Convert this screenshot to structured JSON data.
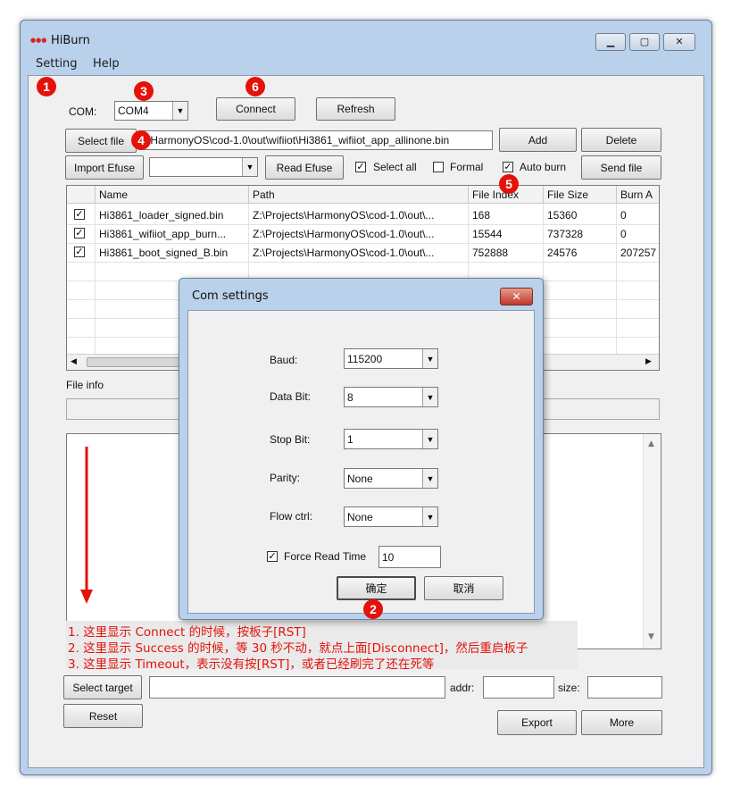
{
  "window": {
    "title": "HiBurn",
    "minimize": "▁",
    "maximize": "▢",
    "close": "✕"
  },
  "menu": {
    "setting": "Setting",
    "help": "Help"
  },
  "com": {
    "label": "COM:",
    "value": "COM4"
  },
  "buttons": {
    "connect": "Connect",
    "refresh": "Refresh",
    "select_file": "Select file",
    "add": "Add",
    "delete": "Delete",
    "import_efuse": "Import Efuse",
    "read_efuse": "Read Efuse",
    "send_file": "Send file",
    "select_target": "Select target",
    "reset": "Reset",
    "export": "Export",
    "more": "More"
  },
  "file_path": "s\\HarmonyOS\\cod-1.0\\out\\wifiiot\\Hi3861_wifiiot_app_allinone.bin",
  "efuse_value": "",
  "checkboxes": {
    "select_all": {
      "label": "Select all",
      "checked": true
    },
    "formal": {
      "label": "Formal",
      "checked": false
    },
    "auto_burn": {
      "label": "Auto burn",
      "checked": true
    }
  },
  "table": {
    "headers": [
      "",
      "Name",
      "Path",
      "File Index",
      "File Size",
      "Burn A"
    ],
    "rows": [
      {
        "checked": true,
        "name": "Hi3861_loader_signed.bin",
        "path": "Z:\\Projects\\HarmonyOS\\cod-1.0\\out\\...",
        "index": "168",
        "size": "15360",
        "burn": "0"
      },
      {
        "checked": true,
        "name": "Hi3861_wifiiot_app_burn...",
        "path": "Z:\\Projects\\HarmonyOS\\cod-1.0\\out\\...",
        "index": "15544",
        "size": "737328",
        "burn": "0"
      },
      {
        "checked": true,
        "name": "Hi3861_boot_signed_B.bin",
        "path": "Z:\\Projects\\HarmonyOS\\cod-1.0\\out\\...",
        "index": "752888",
        "size": "24576",
        "burn": "207257"
      }
    ]
  },
  "file_info": {
    "label": "File info",
    "value": ""
  },
  "target": {
    "value": "",
    "addr_label": "addr:",
    "addr_value": "",
    "size_label": "size:",
    "size_value": ""
  },
  "dialog": {
    "title": "Com settings",
    "close": "✕",
    "baud": {
      "label": "Baud:",
      "value": "115200"
    },
    "data_bit": {
      "label": "Data Bit:",
      "value": "8"
    },
    "stop_bit": {
      "label": "Stop Bit:",
      "value": "1"
    },
    "parity": {
      "label": "Parity:",
      "value": "None"
    },
    "flow_ctrl": {
      "label": "Flow ctrl:",
      "value": "None"
    },
    "force_read_time": {
      "label": "Force Read Time",
      "checked": true,
      "value": "10"
    },
    "ok": "确定",
    "cancel": "取消"
  },
  "annotations": {
    "badges": [
      "1",
      "2",
      "3",
      "4",
      "5",
      "6"
    ],
    "notes": [
      "1. 这里显示 Connect 的时候，按板子[RST]",
      "2. 这里显示 Success 的时候，等 30 秒不动，就点上面[Disconnect]，然后重启板子",
      "3. 这里显示 Timeout，表示没有按[RST]，或者已经刷完了还在死等"
    ],
    "color": "#e4120a"
  },
  "colors": {
    "frame": "#b9d1ea",
    "face": "#f0f0f0",
    "accent": "#e4120a"
  }
}
